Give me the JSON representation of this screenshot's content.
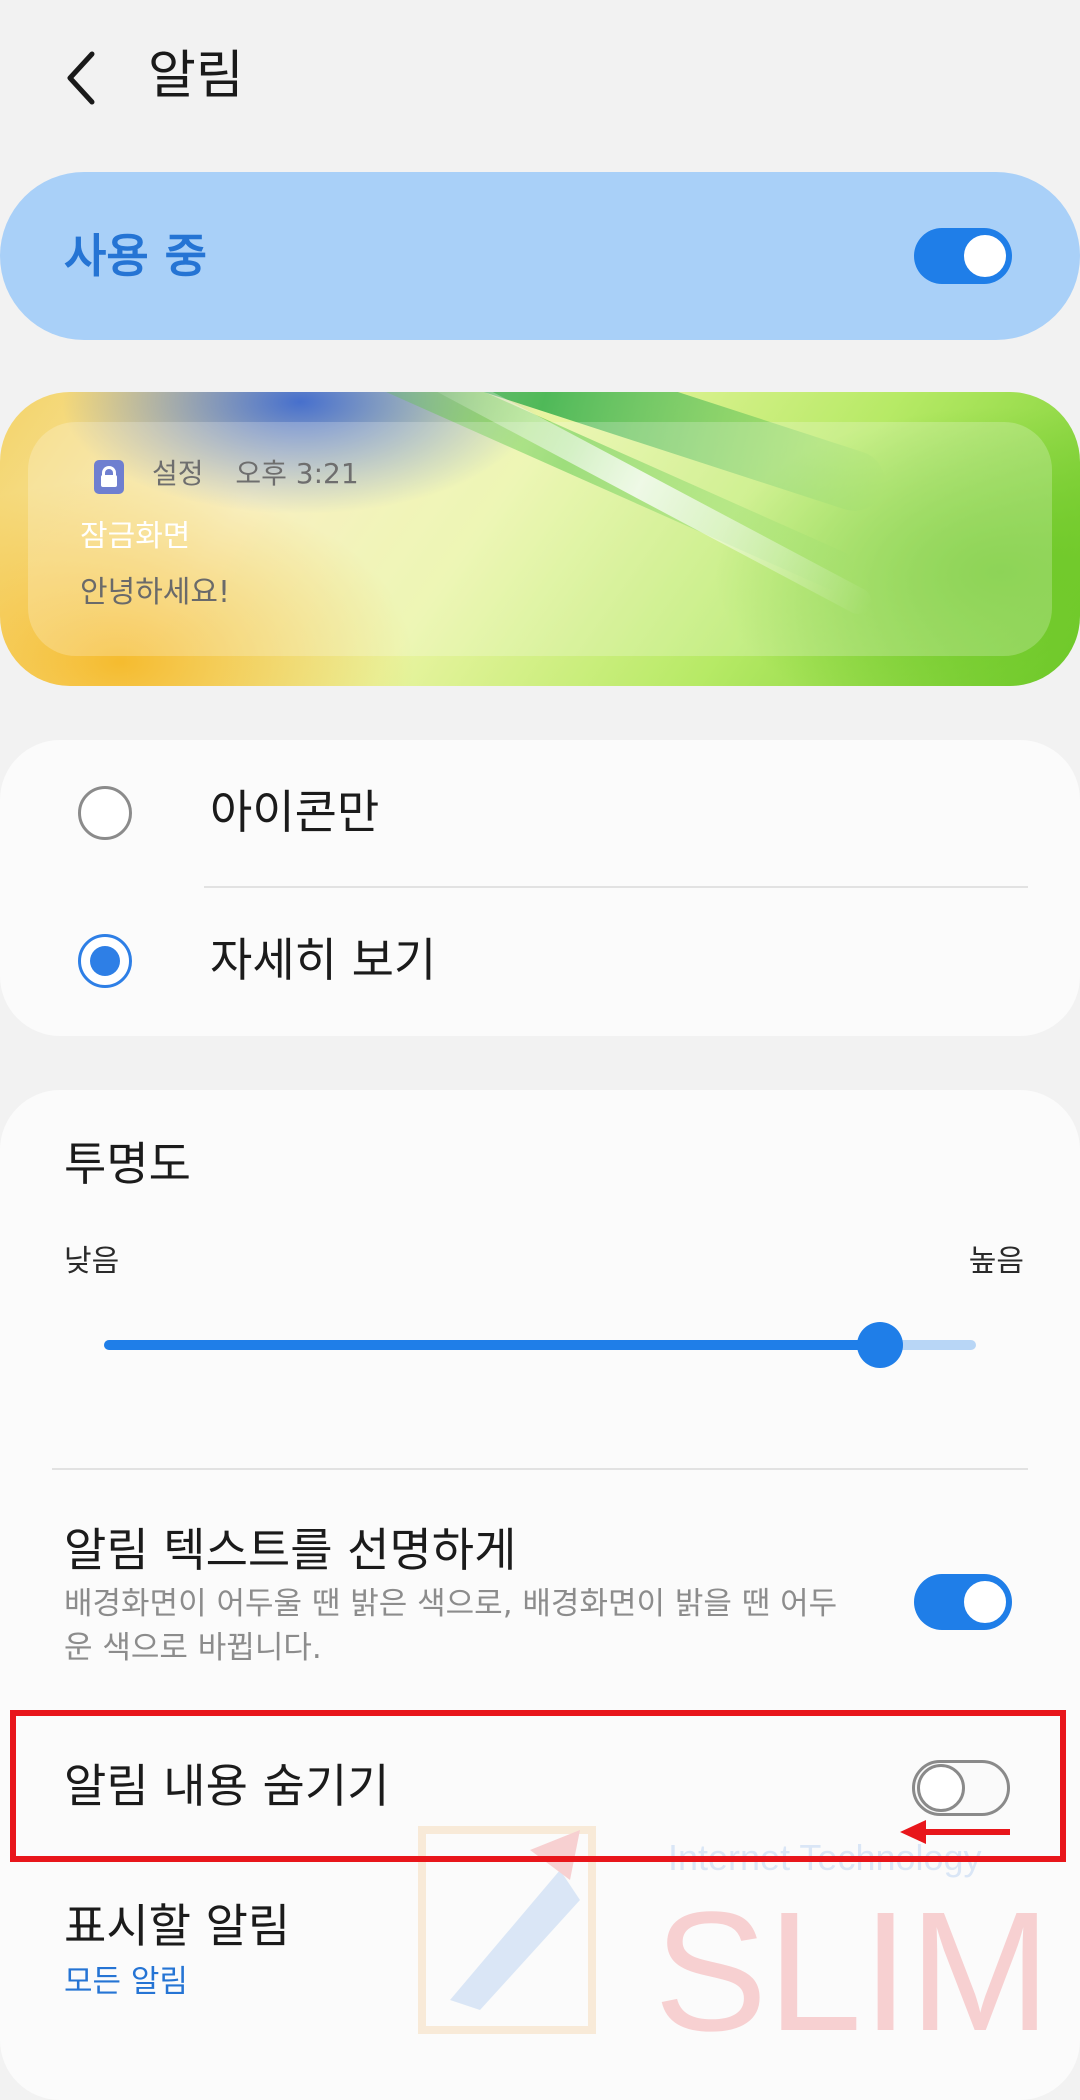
{
  "header": {
    "title": "알림",
    "back_icon": "chevron-left-icon"
  },
  "master": {
    "label": "사용 중",
    "enabled": true
  },
  "preview": {
    "app_name": "설정",
    "time": "오후 3:21",
    "title": "잠금화면",
    "body": "안녕하세요!"
  },
  "style_options": {
    "items": [
      {
        "label": "아이콘만",
        "selected": false
      },
      {
        "label": "자세히 보기",
        "selected": true
      }
    ]
  },
  "transparency": {
    "title": "투명도",
    "low_label": "낮음",
    "high_label": "높음",
    "value_fraction": 0.89
  },
  "settings": {
    "clear_text_title": "알림 텍스트를 선명하게",
    "clear_text_subtitle": "배경화면이 어두울 땐 밝은 색으로, 배경화면이 밝을 땐 어두운 색으로 바뀝니다.",
    "clear_text_enabled": true,
    "hide_content_title": "알림 내용 숨기기",
    "hide_content_enabled": false,
    "notifications_to_show_title": "표시할 알림",
    "notifications_to_show_value": "모든 알림"
  },
  "watermark": {
    "small": "Internet Technology",
    "large": "SLIM"
  },
  "colors": {
    "accent": "#1f7ee8",
    "annotation": "#e8161b"
  }
}
